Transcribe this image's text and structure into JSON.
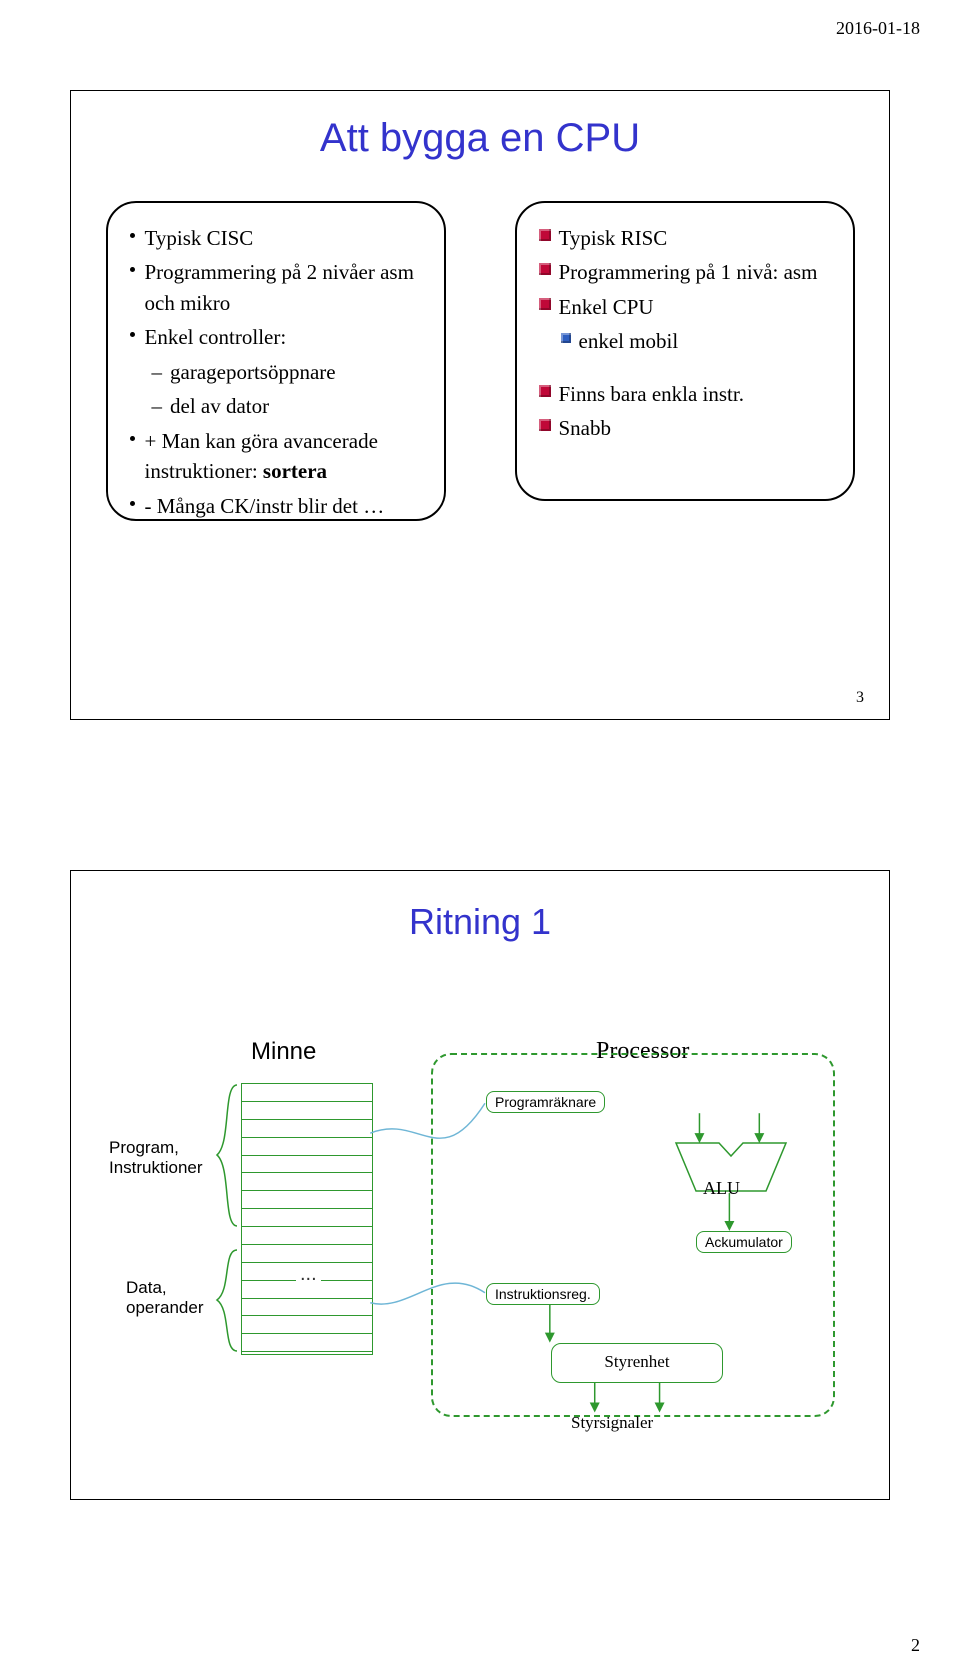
{
  "header_date": "2016-01-18",
  "page_number": "2",
  "slide1": {
    "title": "Att bygga en CPU",
    "slide_num": "3",
    "left": {
      "h1": "Typisk CISC",
      "l1": "Programmering på 2 nivåer asm och mikro",
      "l2": "Enkel controller:",
      "l2a": "garageportsöppnare",
      "l2b": "del av dator",
      "l3a": "+ Man kan göra avancerade instruktioner: ",
      "l3b": "sortera",
      "l4": "- Många CK/instr blir det …"
    },
    "right": {
      "h1": "Typisk RISC",
      "l1": "Programmering på 1 nivå: asm",
      "l2": "Enkel CPU",
      "l2a": "enkel mobil",
      "gap": " ",
      "l3": "Finns bara enkla instr.",
      "l4": "Snabb"
    }
  },
  "slide2": {
    "title": "Ritning 1",
    "minne": "Minne",
    "processor": "Processor",
    "prog_instr": "Program,\nInstruktioner",
    "data_oper": "Data,\noperander",
    "programraknare": "Programräknare",
    "instruktionsreg": "Instruktionsreg.",
    "alu": "ALU",
    "ackumulator": "Ackumulator",
    "styrenhet": "Styrenhet",
    "styrsignaler": "Styrsignaler",
    "ellipsis": "..."
  }
}
